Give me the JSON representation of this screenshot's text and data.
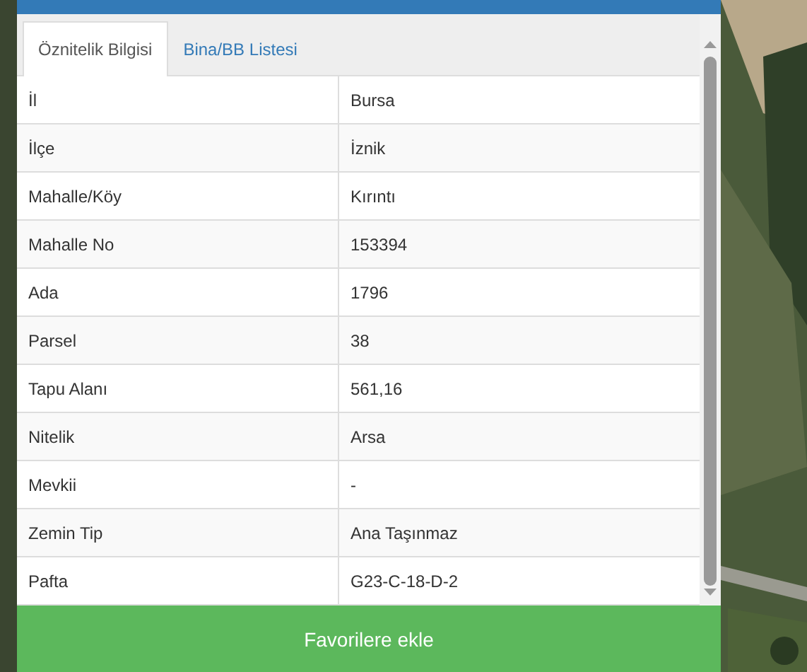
{
  "tabs": [
    {
      "label": "Öznitelik Bilgisi",
      "selected": true
    },
    {
      "label": "Bina/BB Listesi",
      "selected": false
    }
  ],
  "table": {
    "rows": [
      {
        "field": "İl",
        "value": "Bursa"
      },
      {
        "field": "İlçe",
        "value": "İznik"
      },
      {
        "field": "Mahalle/Köy",
        "value": "Kırıntı"
      },
      {
        "field": "Mahalle No",
        "value": "153394"
      },
      {
        "field": "Ada",
        "value": "1796"
      },
      {
        "field": "Parsel",
        "value": "38"
      },
      {
        "field": "Tapu Alanı",
        "value": "561,16"
      },
      {
        "field": "Nitelik",
        "value": "Arsa"
      },
      {
        "field": "Mevkii",
        "value": "-"
      },
      {
        "field": "Zemin Tip",
        "value": "Ana Taşınmaz"
      },
      {
        "field": "Pafta",
        "value": "G23-C-18-D-2"
      }
    ]
  },
  "button": {
    "label": "Favorilere ekle"
  }
}
